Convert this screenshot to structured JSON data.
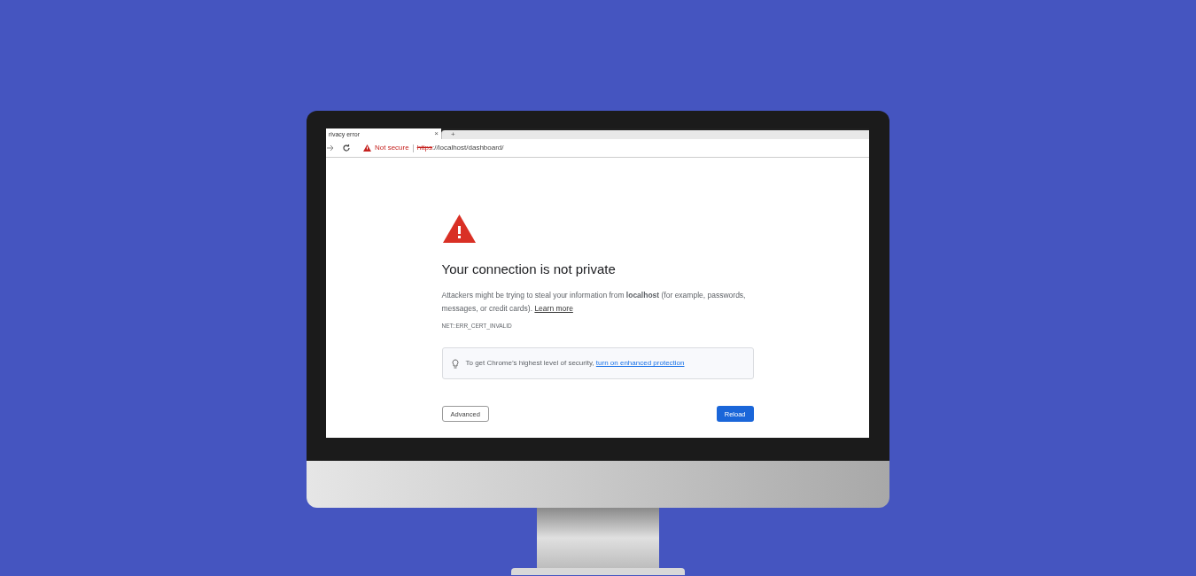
{
  "browser": {
    "tab": {
      "title": "rivacy error",
      "close": "×"
    },
    "new_tab": "+",
    "address_bar": {
      "security_label": "Not secure",
      "scheme": "https",
      "url_rest": "://localhost/dashboard/"
    }
  },
  "page": {
    "heading": "Your connection is not private",
    "message": "Attackers might be trying to steal your information from **localhost** (for example, passwords, messages, or credit cards).",
    "learn_more": "Learn more",
    "error_code": "NET::ERR_CERT_INVALID",
    "tip": {
      "text": "To get Chrome’s highest level of security,",
      "link": "turn on enhanced protection"
    },
    "buttons": [
      {
        "label": "Advanced",
        "kind": "secondary"
      },
      {
        "label": "Reload",
        "kind": "primary"
      }
    ]
  }
}
